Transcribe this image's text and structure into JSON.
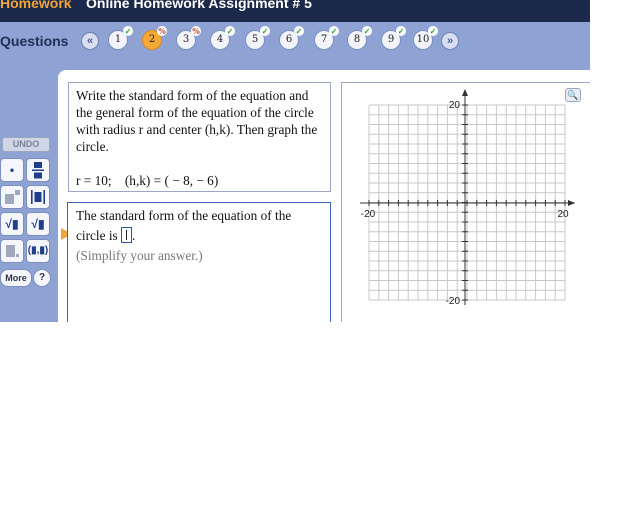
{
  "header": {
    "section": "Homework",
    "assignment_title": "Online Homework Assignment # 5"
  },
  "questions_bar": {
    "label": "Questions",
    "prev_icon": "double-chevron-left-icon",
    "next_icon": "double-chevron-right-icon",
    "items": [
      {
        "number": "1",
        "status": "correct",
        "mark": "✓"
      },
      {
        "number": "2",
        "status": "partial",
        "mark": "%",
        "current": true
      },
      {
        "number": "3",
        "status": "partial",
        "mark": "%"
      },
      {
        "number": "4",
        "status": "correct",
        "mark": "✓"
      },
      {
        "number": "5",
        "status": "correct",
        "mark": "✓"
      },
      {
        "number": "6",
        "status": "correct",
        "mark": "✓"
      },
      {
        "number": "7",
        "status": "correct",
        "mark": "✓"
      },
      {
        "number": "8",
        "status": "correct",
        "mark": "✓"
      },
      {
        "number": "9",
        "status": "correct",
        "mark": "✓"
      },
      {
        "number": "10",
        "status": "correct",
        "mark": "✓"
      }
    ]
  },
  "toolbar": {
    "undo_label": "UNDO",
    "more_label": "More",
    "help_label": "?",
    "tools": [
      {
        "name": "point-tool",
        "glyph": "•"
      },
      {
        "name": "fraction-tool",
        "glyph": "▪/▪"
      },
      {
        "name": "exponent-tool",
        "glyph": "▪²"
      },
      {
        "name": "absolute-value-tool",
        "glyph": "|▪|"
      },
      {
        "name": "square-root-tool",
        "glyph": "√▪"
      },
      {
        "name": "nth-root-tool",
        "glyph": "ⁿ√▪"
      },
      {
        "name": "subscript-tool",
        "glyph": "▪."
      },
      {
        "name": "ordered-pair-tool",
        "glyph": "(▪,▪)"
      }
    ]
  },
  "question": {
    "text": "Write the standard form of the equation and the general form of the equation of the circle with radius r and center (h,k). Then graph the circle.",
    "given": "r = 10;    (h,k) = ( − 8, − 6)"
  },
  "answer": {
    "prompt_line1": "The standard form of the equation of the",
    "prompt_line2_prefix": "circle is",
    "prompt_line2_suffix": ".",
    "hint": "(Simplify your answer.)"
  },
  "graph": {
    "x_min_label": "-20",
    "x_max_label": "20",
    "y_max_label": "20",
    "y_min_label": "-20",
    "zoom_icon": "magnifier-icon"
  }
}
